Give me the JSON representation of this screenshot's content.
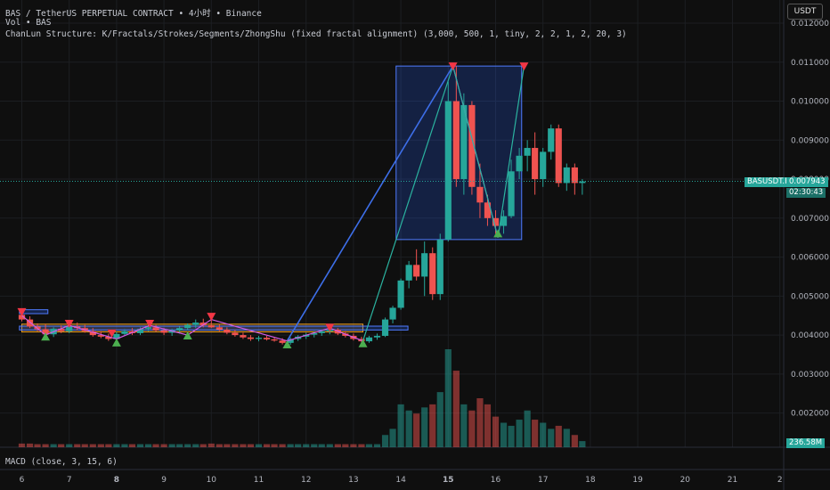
{
  "header": {
    "title": "BAS / TetherUS PERPETUAL CONTRACT • 4小时 • Binance",
    "volume_label": "Vol • BAS",
    "indicator": "ChanLun Structure: K/Fractals/Strokes/Segments/ZhongShu (fixed fractal alignment) (3,000, 500, 1, tiny, 2, 2, 1, 2, 20, 3)",
    "macd": "MACD (close, 3, 15, 6)",
    "currency_button": "USDT"
  },
  "price_tag": {
    "symbol": "BASUSDT.P",
    "price": "0.007943",
    "countdown": "02:30:43",
    "value": 0.007943
  },
  "volume_tag": "236.58M",
  "colors": {
    "up": "#26a69a",
    "down": "#ef5350",
    "stroke_blue": "#3d6ee8",
    "stroke_magenta": "#d05ce3",
    "stroke_teal": "#2bb3a0",
    "zhongshu": "#2962ff",
    "range_orange": "#f0a020"
  },
  "chart_data": {
    "type": "candlestick",
    "x_ticks": [
      "6",
      "7",
      "8",
      "9",
      "10",
      "11",
      "12",
      "13",
      "14",
      "15",
      "16",
      "17",
      "18",
      "19",
      "20",
      "21",
      "2"
    ],
    "y_ticks": [
      "0.012000",
      "0.011000",
      "0.010000",
      "0.009000",
      "0.008000",
      "0.007000",
      "0.006000",
      "0.005000",
      "0.004000",
      "0.003000",
      "0.002000"
    ],
    "ylim": [
      0.0017,
      0.0123
    ],
    "candles": [
      {
        "d": 6.0,
        "o": 0.00452,
        "h": 0.00465,
        "l": 0.00435,
        "c": 0.0044
      },
      {
        "d": 6.17,
        "o": 0.0044,
        "h": 0.00448,
        "l": 0.00418,
        "c": 0.00422
      },
      {
        "d": 6.33,
        "o": 0.00422,
        "h": 0.0043,
        "l": 0.0041,
        "c": 0.00415
      },
      {
        "d": 6.5,
        "o": 0.00415,
        "h": 0.00428,
        "l": 0.00398,
        "c": 0.00402
      },
      {
        "d": 6.67,
        "o": 0.00402,
        "h": 0.0042,
        "l": 0.00395,
        "c": 0.00416
      },
      {
        "d": 6.83,
        "o": 0.00416,
        "h": 0.00425,
        "l": 0.00405,
        "c": 0.0041
      },
      {
        "d": 7.0,
        "o": 0.0041,
        "h": 0.00428,
        "l": 0.00405,
        "c": 0.00422
      },
      {
        "d": 7.17,
        "o": 0.00422,
        "h": 0.00432,
        "l": 0.00412,
        "c": 0.00418
      },
      {
        "d": 7.33,
        "o": 0.00418,
        "h": 0.00426,
        "l": 0.00406,
        "c": 0.0041
      },
      {
        "d": 7.5,
        "o": 0.0041,
        "h": 0.00418,
        "l": 0.00396,
        "c": 0.004
      },
      {
        "d": 7.67,
        "o": 0.004,
        "h": 0.0041,
        "l": 0.00392,
        "c": 0.00396
      },
      {
        "d": 7.83,
        "o": 0.00396,
        "h": 0.00404,
        "l": 0.00385,
        "c": 0.0039
      },
      {
        "d": 8.0,
        "o": 0.0039,
        "h": 0.00408,
        "l": 0.00382,
        "c": 0.00403
      },
      {
        "d": 8.17,
        "o": 0.00403,
        "h": 0.00415,
        "l": 0.00398,
        "c": 0.0041
      },
      {
        "d": 8.33,
        "o": 0.0041,
        "h": 0.00418,
        "l": 0.004,
        "c": 0.00405
      },
      {
        "d": 8.5,
        "o": 0.00405,
        "h": 0.0042,
        "l": 0.004,
        "c": 0.00416
      },
      {
        "d": 8.67,
        "o": 0.00416,
        "h": 0.00428,
        "l": 0.0041,
        "c": 0.0042
      },
      {
        "d": 8.83,
        "o": 0.0042,
        "h": 0.00426,
        "l": 0.00408,
        "c": 0.00412
      },
      {
        "d": 9.0,
        "o": 0.00412,
        "h": 0.00418,
        "l": 0.004,
        "c": 0.00406
      },
      {
        "d": 9.17,
        "o": 0.00406,
        "h": 0.00416,
        "l": 0.00398,
        "c": 0.00412
      },
      {
        "d": 9.33,
        "o": 0.00412,
        "h": 0.00422,
        "l": 0.00404,
        "c": 0.00418
      },
      {
        "d": 9.5,
        "o": 0.00418,
        "h": 0.0043,
        "l": 0.00412,
        "c": 0.00426
      },
      {
        "d": 9.67,
        "o": 0.00426,
        "h": 0.0044,
        "l": 0.00418,
        "c": 0.00432
      },
      {
        "d": 9.83,
        "o": 0.00432,
        "h": 0.00442,
        "l": 0.0042,
        "c": 0.00425
      },
      {
        "d": 10.0,
        "o": 0.00425,
        "h": 0.00448,
        "l": 0.00418,
        "c": 0.0042
      },
      {
        "d": 10.17,
        "o": 0.0042,
        "h": 0.00428,
        "l": 0.0041,
        "c": 0.00414
      },
      {
        "d": 10.33,
        "o": 0.00414,
        "h": 0.0042,
        "l": 0.00402,
        "c": 0.00406
      },
      {
        "d": 10.5,
        "o": 0.00406,
        "h": 0.00414,
        "l": 0.00396,
        "c": 0.004
      },
      {
        "d": 10.67,
        "o": 0.004,
        "h": 0.00406,
        "l": 0.0039,
        "c": 0.00394
      },
      {
        "d": 10.83,
        "o": 0.00394,
        "h": 0.004,
        "l": 0.00385,
        "c": 0.0039
      },
      {
        "d": 11.0,
        "o": 0.0039,
        "h": 0.00398,
        "l": 0.00384,
        "c": 0.00393
      },
      {
        "d": 11.17,
        "o": 0.00393,
        "h": 0.00398,
        "l": 0.00386,
        "c": 0.00389
      },
      {
        "d": 11.33,
        "o": 0.00389,
        "h": 0.00395,
        "l": 0.00383,
        "c": 0.00386
      },
      {
        "d": 11.5,
        "o": 0.00386,
        "h": 0.00392,
        "l": 0.00376,
        "c": 0.0038
      },
      {
        "d": 11.67,
        "o": 0.0038,
        "h": 0.00394,
        "l": 0.00375,
        "c": 0.0039
      },
      {
        "d": 11.83,
        "o": 0.0039,
        "h": 0.004,
        "l": 0.00385,
        "c": 0.00396
      },
      {
        "d": 12.0,
        "o": 0.00396,
        "h": 0.00406,
        "l": 0.0039,
        "c": 0.00401
      },
      {
        "d": 12.17,
        "o": 0.00401,
        "h": 0.0041,
        "l": 0.00394,
        "c": 0.00405
      },
      {
        "d": 12.33,
        "o": 0.00405,
        "h": 0.00414,
        "l": 0.00398,
        "c": 0.0041
      },
      {
        "d": 12.5,
        "o": 0.0041,
        "h": 0.0042,
        "l": 0.00402,
        "c": 0.00414
      },
      {
        "d": 12.67,
        "o": 0.00414,
        "h": 0.00418,
        "l": 0.004,
        "c": 0.00404
      },
      {
        "d": 12.83,
        "o": 0.00404,
        "h": 0.0041,
        "l": 0.00394,
        "c": 0.00398
      },
      {
        "d": 13.0,
        "o": 0.00398,
        "h": 0.00404,
        "l": 0.00386,
        "c": 0.0039
      },
      {
        "d": 13.17,
        "o": 0.0039,
        "h": 0.00396,
        "l": 0.00378,
        "c": 0.00384
      },
      {
        "d": 13.33,
        "o": 0.00384,
        "h": 0.00398,
        "l": 0.0038,
        "c": 0.00394
      },
      {
        "d": 13.5,
        "o": 0.00394,
        "h": 0.00404,
        "l": 0.00388,
        "c": 0.00398
      },
      {
        "d": 13.67,
        "o": 0.00398,
        "h": 0.00445,
        "l": 0.00395,
        "c": 0.0044
      },
      {
        "d": 13.83,
        "o": 0.0044,
        "h": 0.00475,
        "l": 0.0043,
        "c": 0.0047
      },
      {
        "d": 14.0,
        "o": 0.0047,
        "h": 0.00545,
        "l": 0.00465,
        "c": 0.0054
      },
      {
        "d": 14.17,
        "o": 0.0054,
        "h": 0.0059,
        "l": 0.0052,
        "c": 0.0058
      },
      {
        "d": 14.33,
        "o": 0.0058,
        "h": 0.0062,
        "l": 0.0054,
        "c": 0.0055
      },
      {
        "d": 14.5,
        "o": 0.0055,
        "h": 0.0064,
        "l": 0.005,
        "c": 0.0061
      },
      {
        "d": 14.67,
        "o": 0.0061,
        "h": 0.00625,
        "l": 0.0049,
        "c": 0.00505
      },
      {
        "d": 14.83,
        "o": 0.00505,
        "h": 0.0066,
        "l": 0.0049,
        "c": 0.00645
      },
      {
        "d": 15.0,
        "o": 0.00645,
        "h": 0.0105,
        "l": 0.0064,
        "c": 0.01
      },
      {
        "d": 15.17,
        "o": 0.01,
        "h": 0.0109,
        "l": 0.0078,
        "c": 0.008
      },
      {
        "d": 15.33,
        "o": 0.008,
        "h": 0.0102,
        "l": 0.0076,
        "c": 0.0099
      },
      {
        "d": 15.5,
        "o": 0.0099,
        "h": 0.01,
        "l": 0.0076,
        "c": 0.0078
      },
      {
        "d": 15.67,
        "o": 0.0078,
        "h": 0.0084,
        "l": 0.007,
        "c": 0.0074
      },
      {
        "d": 15.83,
        "o": 0.0074,
        "h": 0.0076,
        "l": 0.0068,
        "c": 0.007
      },
      {
        "d": 16.0,
        "o": 0.007,
        "h": 0.0072,
        "l": 0.0066,
        "c": 0.0068
      },
      {
        "d": 16.17,
        "o": 0.0068,
        "h": 0.0072,
        "l": 0.0066,
        "c": 0.00705
      },
      {
        "d": 16.33,
        "o": 0.00705,
        "h": 0.0085,
        "l": 0.007,
        "c": 0.0082
      },
      {
        "d": 16.5,
        "o": 0.0082,
        "h": 0.0088,
        "l": 0.008,
        "c": 0.0086
      },
      {
        "d": 16.67,
        "o": 0.0086,
        "h": 0.009,
        "l": 0.0082,
        "c": 0.0088
      },
      {
        "d": 16.83,
        "o": 0.0088,
        "h": 0.0092,
        "l": 0.0076,
        "c": 0.008
      },
      {
        "d": 17.0,
        "o": 0.008,
        "h": 0.0088,
        "l": 0.0078,
        "c": 0.0087
      },
      {
        "d": 17.17,
        "o": 0.0087,
        "h": 0.0094,
        "l": 0.0085,
        "c": 0.0093
      },
      {
        "d": 17.33,
        "o": 0.0093,
        "h": 0.0094,
        "l": 0.0078,
        "c": 0.0079
      },
      {
        "d": 17.5,
        "o": 0.0079,
        "h": 0.0084,
        "l": 0.0077,
        "c": 0.0083
      },
      {
        "d": 17.67,
        "o": 0.0083,
        "h": 0.0084,
        "l": 0.0076,
        "c": 0.0079
      },
      {
        "d": 17.83,
        "o": 0.0079,
        "h": 0.008,
        "l": 0.0076,
        "c": 0.00794
      }
    ],
    "volume": [
      6,
      6,
      5,
      5,
      5,
      5,
      5,
      5,
      5,
      5,
      5,
      5,
      5,
      5,
      5,
      5,
      5,
      5,
      5,
      5,
      5,
      5,
      5,
      5,
      6,
      5,
      5,
      5,
      5,
      5,
      5,
      5,
      5,
      5,
      5,
      5,
      5,
      5,
      5,
      5,
      5,
      5,
      5,
      5,
      5,
      5,
      20,
      30,
      70,
      60,
      55,
      65,
      70,
      90,
      160,
      125,
      70,
      60,
      80,
      70,
      50,
      40,
      35,
      45,
      60,
      45,
      40,
      30,
      35,
      30,
      20,
      10
    ],
    "zhongshu": {
      "x": [
        13.9,
        16.55
      ],
      "y": [
        0.00645,
        0.0109
      ]
    },
    "ranges": [
      {
        "x": [
          6.0,
          13.2
        ],
        "y": [
          0.00408,
          0.00428
        ],
        "color": "orange"
      },
      {
        "x": [
          5.95,
          14.15
        ],
        "y": [
          0.00413,
          0.00423
        ],
        "color": "blue"
      },
      {
        "x": [
          5.95,
          6.55
        ],
        "y": [
          0.00455,
          0.00465
        ],
        "color": "blue"
      }
    ],
    "strokes": [
      {
        "color": "blue",
        "points": [
          [
            11.6,
            0.00385
          ],
          [
            15.1,
            0.0109
          ]
        ]
      },
      {
        "color": "teal",
        "points": [
          [
            13.2,
            0.00385
          ],
          [
            15.1,
            0.0109
          ]
        ]
      },
      {
        "color": "magenta",
        "points": [
          [
            15.1,
            0.0109
          ],
          [
            16.05,
            0.0065
          ]
        ]
      },
      {
        "color": "teal",
        "points": [
          [
            16.05,
            0.0065
          ],
          [
            16.6,
            0.0109
          ]
        ]
      },
      {
        "color": "teal",
        "points": [
          [
            15.1,
            0.0109
          ],
          [
            16.05,
            0.0065
          ]
        ]
      },
      {
        "color": "magenta",
        "points": [
          [
            6.0,
            0.0045
          ],
          [
            6.5,
            0.004
          ],
          [
            7.0,
            0.00425
          ],
          [
            8.0,
            0.0039
          ],
          [
            8.7,
            0.00425
          ],
          [
            9.5,
            0.004
          ],
          [
            10.0,
            0.0044
          ],
          [
            11.6,
            0.00385
          ],
          [
            12.5,
            0.00418
          ],
          [
            13.2,
            0.00385
          ]
        ]
      }
    ],
    "fractals_top": [
      [
        6.0,
        0.0046
      ],
      [
        7.0,
        0.0043
      ],
      [
        7.9,
        0.00405
      ],
      [
        8.7,
        0.0043
      ],
      [
        10.0,
        0.00448
      ],
      [
        12.5,
        0.0042
      ],
      [
        15.1,
        0.0109
      ],
      [
        16.6,
        0.0109
      ]
    ],
    "fractals_bottom": [
      [
        6.5,
        0.00395
      ],
      [
        8.0,
        0.0038
      ],
      [
        9.5,
        0.00398
      ],
      [
        11.6,
        0.00375
      ],
      [
        13.2,
        0.00378
      ],
      [
        16.05,
        0.0066
      ]
    ]
  }
}
